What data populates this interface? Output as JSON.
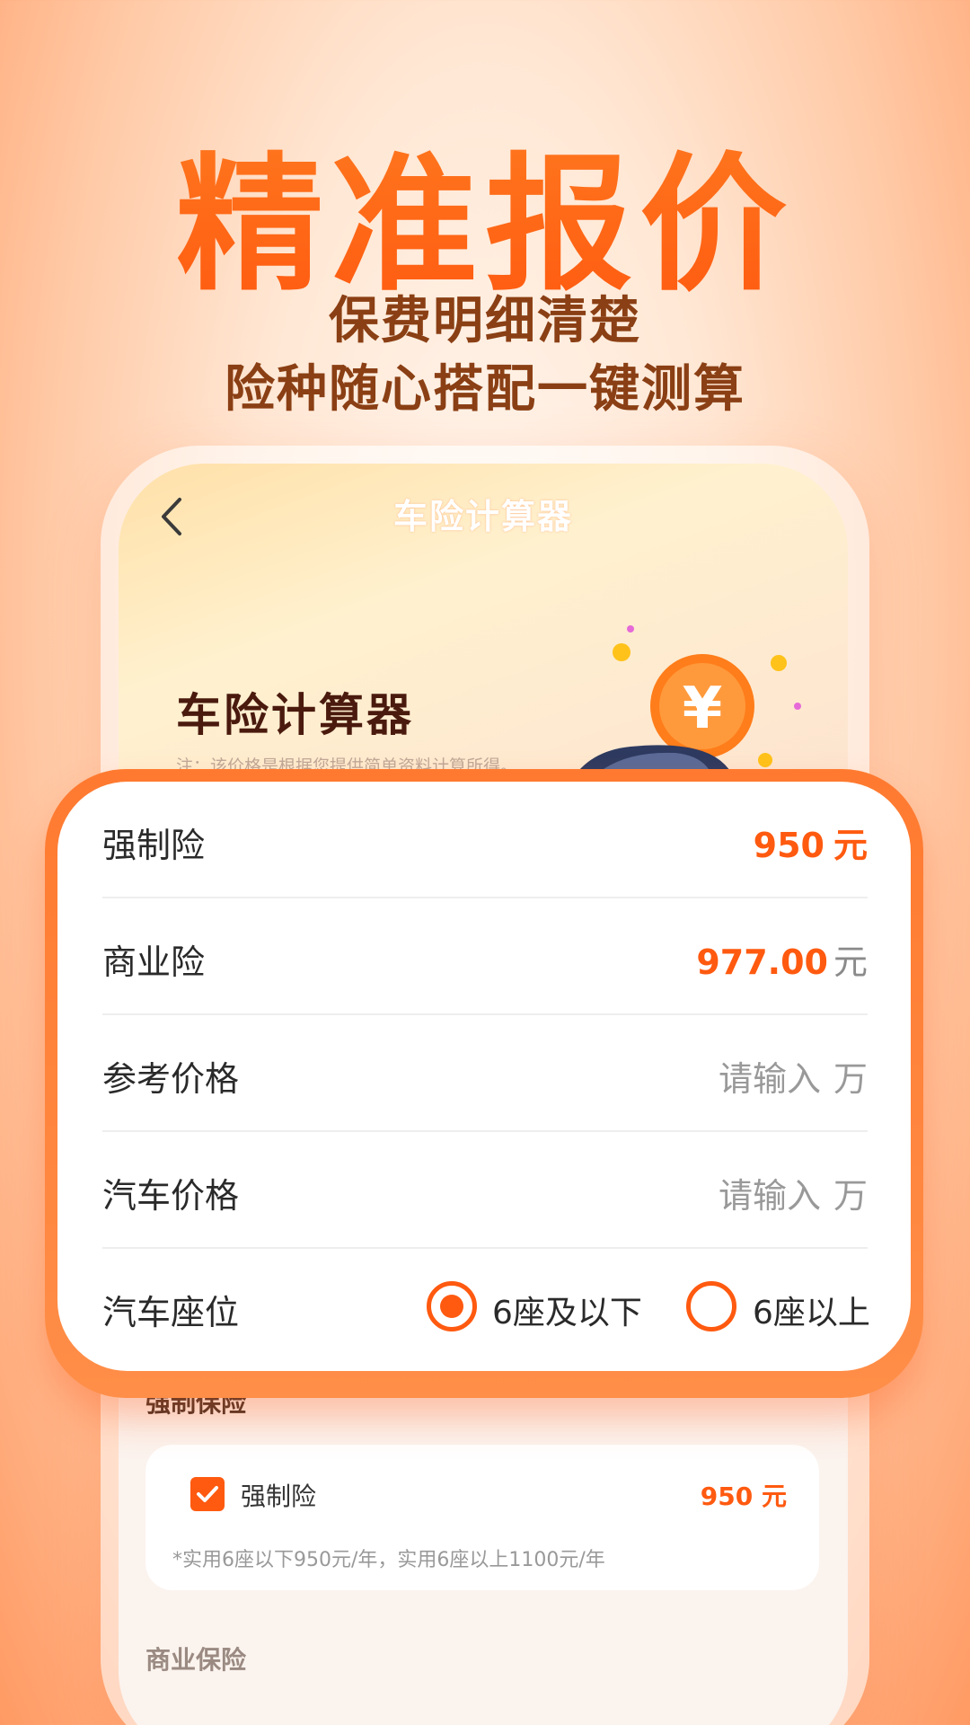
{
  "promo": {
    "headline": "精准报价",
    "line1": "保费明细清楚",
    "line2": "险种随心搭配一键测算"
  },
  "app": {
    "nav_title": "车险计算器",
    "hero_title": "车险计算器",
    "hero_note": "注：该价格是根据您提供简单资料计算所得。"
  },
  "calc": {
    "rows": [
      {
        "label": "强制险",
        "amount": "950",
        "unit": "元"
      },
      {
        "label": "商业险",
        "amount": "977.00",
        "unit": "元"
      },
      {
        "label": "参考价格",
        "placeholder": "请输入",
        "unit": "万"
      },
      {
        "label": "汽车价格",
        "placeholder": "请输入",
        "unit": "万"
      }
    ],
    "seat": {
      "label": "汽车座位",
      "option1": "6座及以下",
      "option2": "6座以上",
      "selected": "6座及以下"
    }
  },
  "compulsory_section": {
    "heading": "强制保险",
    "item_label": "强制险",
    "item_price": "950 元",
    "note": "*实用6座以下950元/年，实用6座以上1100元/年"
  },
  "commercial_section": {
    "heading": "商业保险"
  },
  "colors": {
    "accent": "#ff5a10",
    "headline": "#ff6a14",
    "subline": "#8a3f14"
  }
}
